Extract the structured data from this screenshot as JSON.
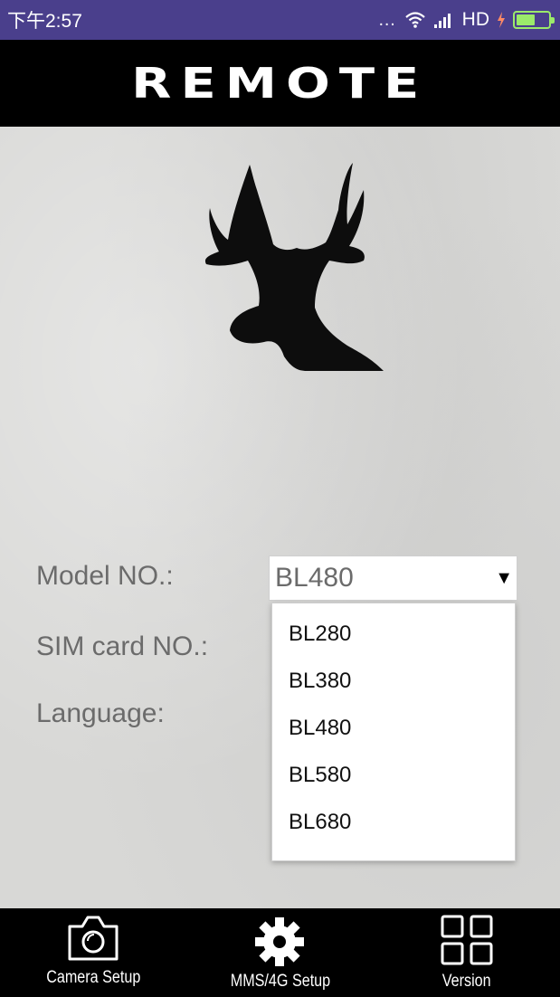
{
  "status_bar": {
    "time": "下午2:57",
    "network_label": "HD",
    "icons": [
      "more-dots-icon",
      "wifi-icon",
      "signal-icon",
      "charging-icon",
      "battery-icon"
    ]
  },
  "header": {
    "title": "REMOTE"
  },
  "logo": {
    "name": "deer-head-logo"
  },
  "form": {
    "model_label": "Model NO.:",
    "model_value": "BL480",
    "sim_label": "SIM card NO.:",
    "language_label": "Language:"
  },
  "dropdown": {
    "options": [
      "BL280",
      "BL380",
      "BL480",
      "BL580",
      "BL680"
    ]
  },
  "bottom_nav": {
    "items": [
      {
        "label": "Camera Setup",
        "icon": "camera-icon"
      },
      {
        "label": "MMS/4G Setup",
        "icon": "gear-icon"
      },
      {
        "label": "Version",
        "icon": "grid-icon"
      }
    ]
  },
  "colors": {
    "status_bar_bg": "#4a3f8c",
    "header_bg": "#000000",
    "label_text": "#6b6b6b",
    "battery": "#9bea6a"
  }
}
